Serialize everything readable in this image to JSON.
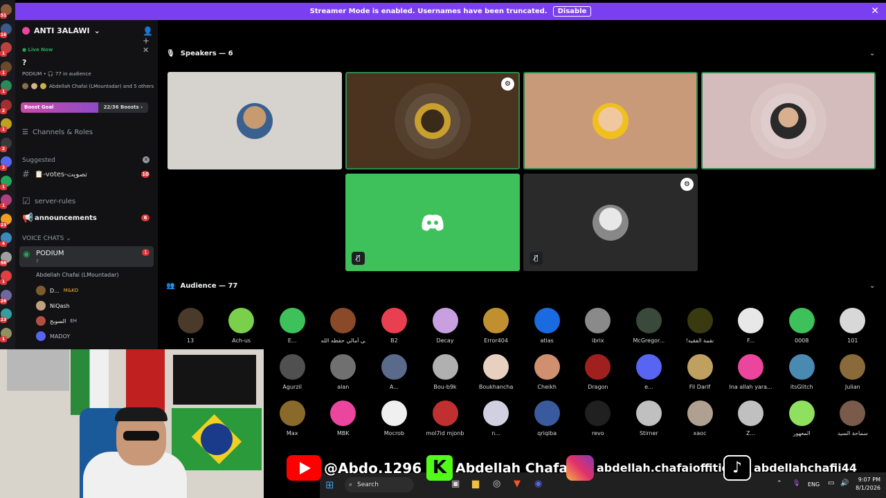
{
  "banner": {
    "message": "Streamer Mode is enabled. Usernames have been truncated.",
    "disable_label": "Disable",
    "close": "✕"
  },
  "rail_badges": [
    "51",
    "16",
    "1",
    "1",
    "1",
    "2",
    "1",
    "2",
    "3",
    "1",
    "1",
    "23",
    "4",
    "98",
    "1",
    "26",
    "23",
    "1"
  ],
  "sidebar": {
    "server_name": "ANTI 3ALAWI",
    "live_label": "Live Now",
    "stage_topic": "?",
    "stage_meta": "PODIUM • 🎧 77 in audience",
    "stage_people": "Abdellah Chafai (LMountadar) and 5 others",
    "boost_label": "Boost Goal",
    "boost_count": "22/36 Boosts",
    "boost_fraction": 0.61,
    "channels_roles": "Channels & Roles",
    "suggested": "Suggested",
    "channels": [
      {
        "name": "📋-votes-تصويت",
        "badge": "10"
      },
      {
        "name": "server-rules",
        "badge": ""
      },
      {
        "name": "announcements",
        "badge": "6"
      }
    ],
    "voice_header": "VOICE CHATS",
    "podium": {
      "name": "PODIUM",
      "sub": "?",
      "badge": "1"
    },
    "voice_users": [
      "Abdellah Chafai (LMountadar)",
      "D...",
      "NiQash",
      "السويح",
      "MADOY"
    ],
    "voice_tags": [
      "",
      "M&KO",
      "",
      "EH",
      ""
    ]
  },
  "speakers_header": "Speakers — 6",
  "audience_header": "Audience — 77",
  "audience": [
    "13",
    "Ach-us",
    "E...",
    "علي آمالي حفظه الله...",
    "B2",
    "Decay",
    "Error404",
    "atlas",
    "ibrix",
    "McGregor...",
    "!نقمة الفقيه",
    "F...",
    "0008",
    "101",
    "Agurzil",
    "alan",
    "A...",
    "Bou-b9k",
    "Boukhancha",
    "Cheikh",
    "Dragon",
    "e...",
    "Fil Darif",
    "Ina allah yara...",
    "itsGlitch",
    "Julian",
    "Max",
    "MBK",
    "Mocrob",
    "mol7id mjonb",
    "n...",
    "qriqiba",
    "revo",
    "Stirner",
    "xaoc",
    "Z...",
    "المعهور",
    "سماحة السيد"
  ],
  "social": {
    "youtube": "@Abdo.1296",
    "kick": "Abdellah Chafai",
    "instagram": "abdellah.chafaioffitid",
    "tiktok": "abdellahchafii44"
  },
  "taskbar": {
    "search": "Search",
    "lang": "ENG",
    "time": "9:07 PM",
    "date": "8/1/2026"
  },
  "colors": {
    "banner": "#7b3ff2",
    "speaking": "#2e8b4f",
    "discord": "#5865f2",
    "live": "#23a55a",
    "badge": "#da373c"
  }
}
